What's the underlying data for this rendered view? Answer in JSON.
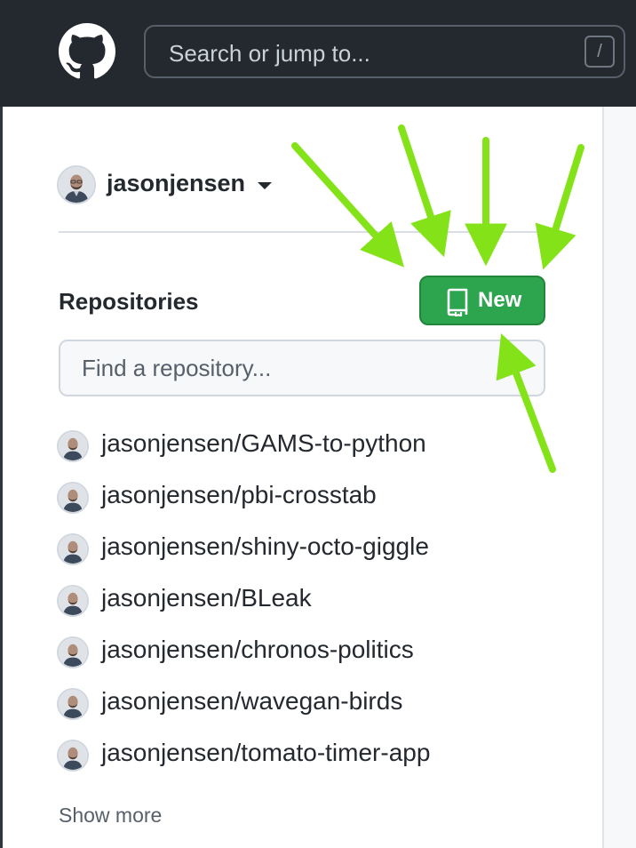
{
  "header": {
    "logo_icon": "github-mark-icon",
    "search": {
      "placeholder": "Search or jump to...",
      "shortcut": "/"
    }
  },
  "user": {
    "name": "jasonjensen",
    "avatar_icon": "user-avatar-icon",
    "menu_icon": "caret-down-icon"
  },
  "repositories": {
    "heading": "Repositories",
    "new_button": {
      "label": "New",
      "icon": "repo-icon"
    },
    "filter": {
      "placeholder": "Find a repository..."
    },
    "items": [
      {
        "name": "jasonjensen/GAMS-to-python"
      },
      {
        "name": "jasonjensen/pbi-crosstab"
      },
      {
        "name": "jasonjensen/shiny-octo-giggle"
      },
      {
        "name": "jasonjensen/BLeak"
      },
      {
        "name": "jasonjensen/chronos-politics"
      },
      {
        "name": "jasonjensen/wavegan-birds"
      },
      {
        "name": "jasonjensen/tomato-timer-app"
      }
    ],
    "show_more": "Show more"
  },
  "colors": {
    "header_bg": "#24292f",
    "primary_button": "#2da44e",
    "annotation_arrow": "#84e318"
  }
}
